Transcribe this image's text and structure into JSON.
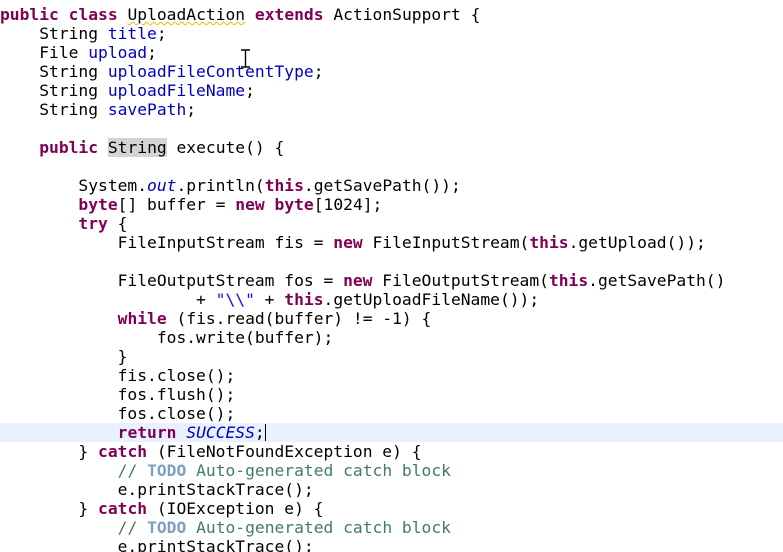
{
  "editor": {
    "language": "java",
    "colors": {
      "background": "#ffffff",
      "keyword": "#7f0055",
      "field": "#0000c0",
      "string": "#2a00ff",
      "comment": "#3f7f5f",
      "todo_tag": "#7f9fbf",
      "current_line": "#e8f2fe",
      "occurrence_highlight": "#d4d4d4"
    },
    "mouse_cursor": "text-ibeam-icon",
    "lines": [
      "public class UploadAction extends ActionSupport {",
      "    String title;",
      "    File upload;",
      "    String uploadFileContentType;",
      "    String uploadFileName;",
      "    String savePath;",
      "",
      "    public String execute() {",
      "",
      "        System.out.println(this.getSavePath());",
      "        byte[] buffer = new byte[1024];",
      "        try {",
      "            FileInputStream fis = new FileInputStream(this.getUpload());",
      "",
      "            FileOutputStream fos = new FileOutputStream(this.getSavePath()",
      "                    + \"\\\\\" + this.getUploadFileName());",
      "            while (fis.read(buffer) != -1) {",
      "                fos.write(buffer);",
      "            }",
      "            fis.close();",
      "            fos.flush();",
      "            fos.close();",
      "            return SUCCESS;",
      "        } catch (FileNotFoundException e) {",
      "            // TODO Auto-generated catch block",
      "            e.printStackTrace();",
      "        } catch (IOException e) {",
      "            // TODO Auto-generated catch block",
      "            e.printStackTrace();"
    ]
  }
}
